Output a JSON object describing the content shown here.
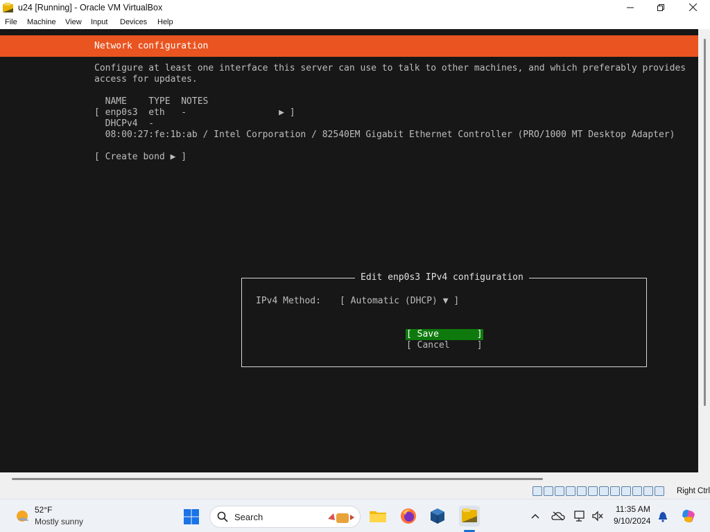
{
  "window": {
    "title": "u24 [Running] - Oracle VM VirtualBox",
    "controls": {
      "minimize": "minimize-icon",
      "maximize": "restore-icon",
      "close": "close-icon"
    }
  },
  "menu": [
    "File",
    "Machine",
    "View",
    "Input",
    "Devices",
    "Help"
  ],
  "installer": {
    "header_title": "Network configuration",
    "description_line1": "Configure at least one interface this server can use to talk to other machines, and which preferably provides",
    "description_line2": "access for updates.",
    "columns_row": "  NAME    TYPE  NOTES",
    "interface_row": "[ enp0s3  eth   -                 ▶ ]",
    "dhcp_row": "  DHCPv4  -",
    "mac_row": "  08:00:27:fe:1b:ab / Intel Corporation / 82540EM Gigabit Ethernet Controller (PRO/1000 MT Desktop Adapter)",
    "create_bond": "[ Create bond ▶ ]"
  },
  "dialog": {
    "title": "Edit enp0s3 IPv4 configuration",
    "method_label": "IPv4 Method:",
    "method_value": "[ Automatic (DHCP) ▼ ]",
    "save_button": "[ Save       ]",
    "cancel_button": "[ Cancel     ]",
    "highlight_color": "#0e7a0d"
  },
  "colors": {
    "header": "#e95420",
    "terminal_bg": "#171717"
  },
  "vbox_status": {
    "host_key": "Right Ctrl",
    "icons": [
      "hard-disk-icon",
      "optical-drive-icon",
      "audio-icon",
      "network-icon",
      "usb-icon",
      "shared-folders-icon",
      "display-icon",
      "recording-icon",
      "cpu-icon",
      "mouse-integration-icon",
      "keyboard-capture-icon",
      "host-key-icon"
    ]
  },
  "taskbar": {
    "weather_temp": "52°F",
    "weather_desc": "Mostly sunny",
    "search_label": "Search",
    "time": "11:35 AM",
    "date": "9/10/2024"
  }
}
